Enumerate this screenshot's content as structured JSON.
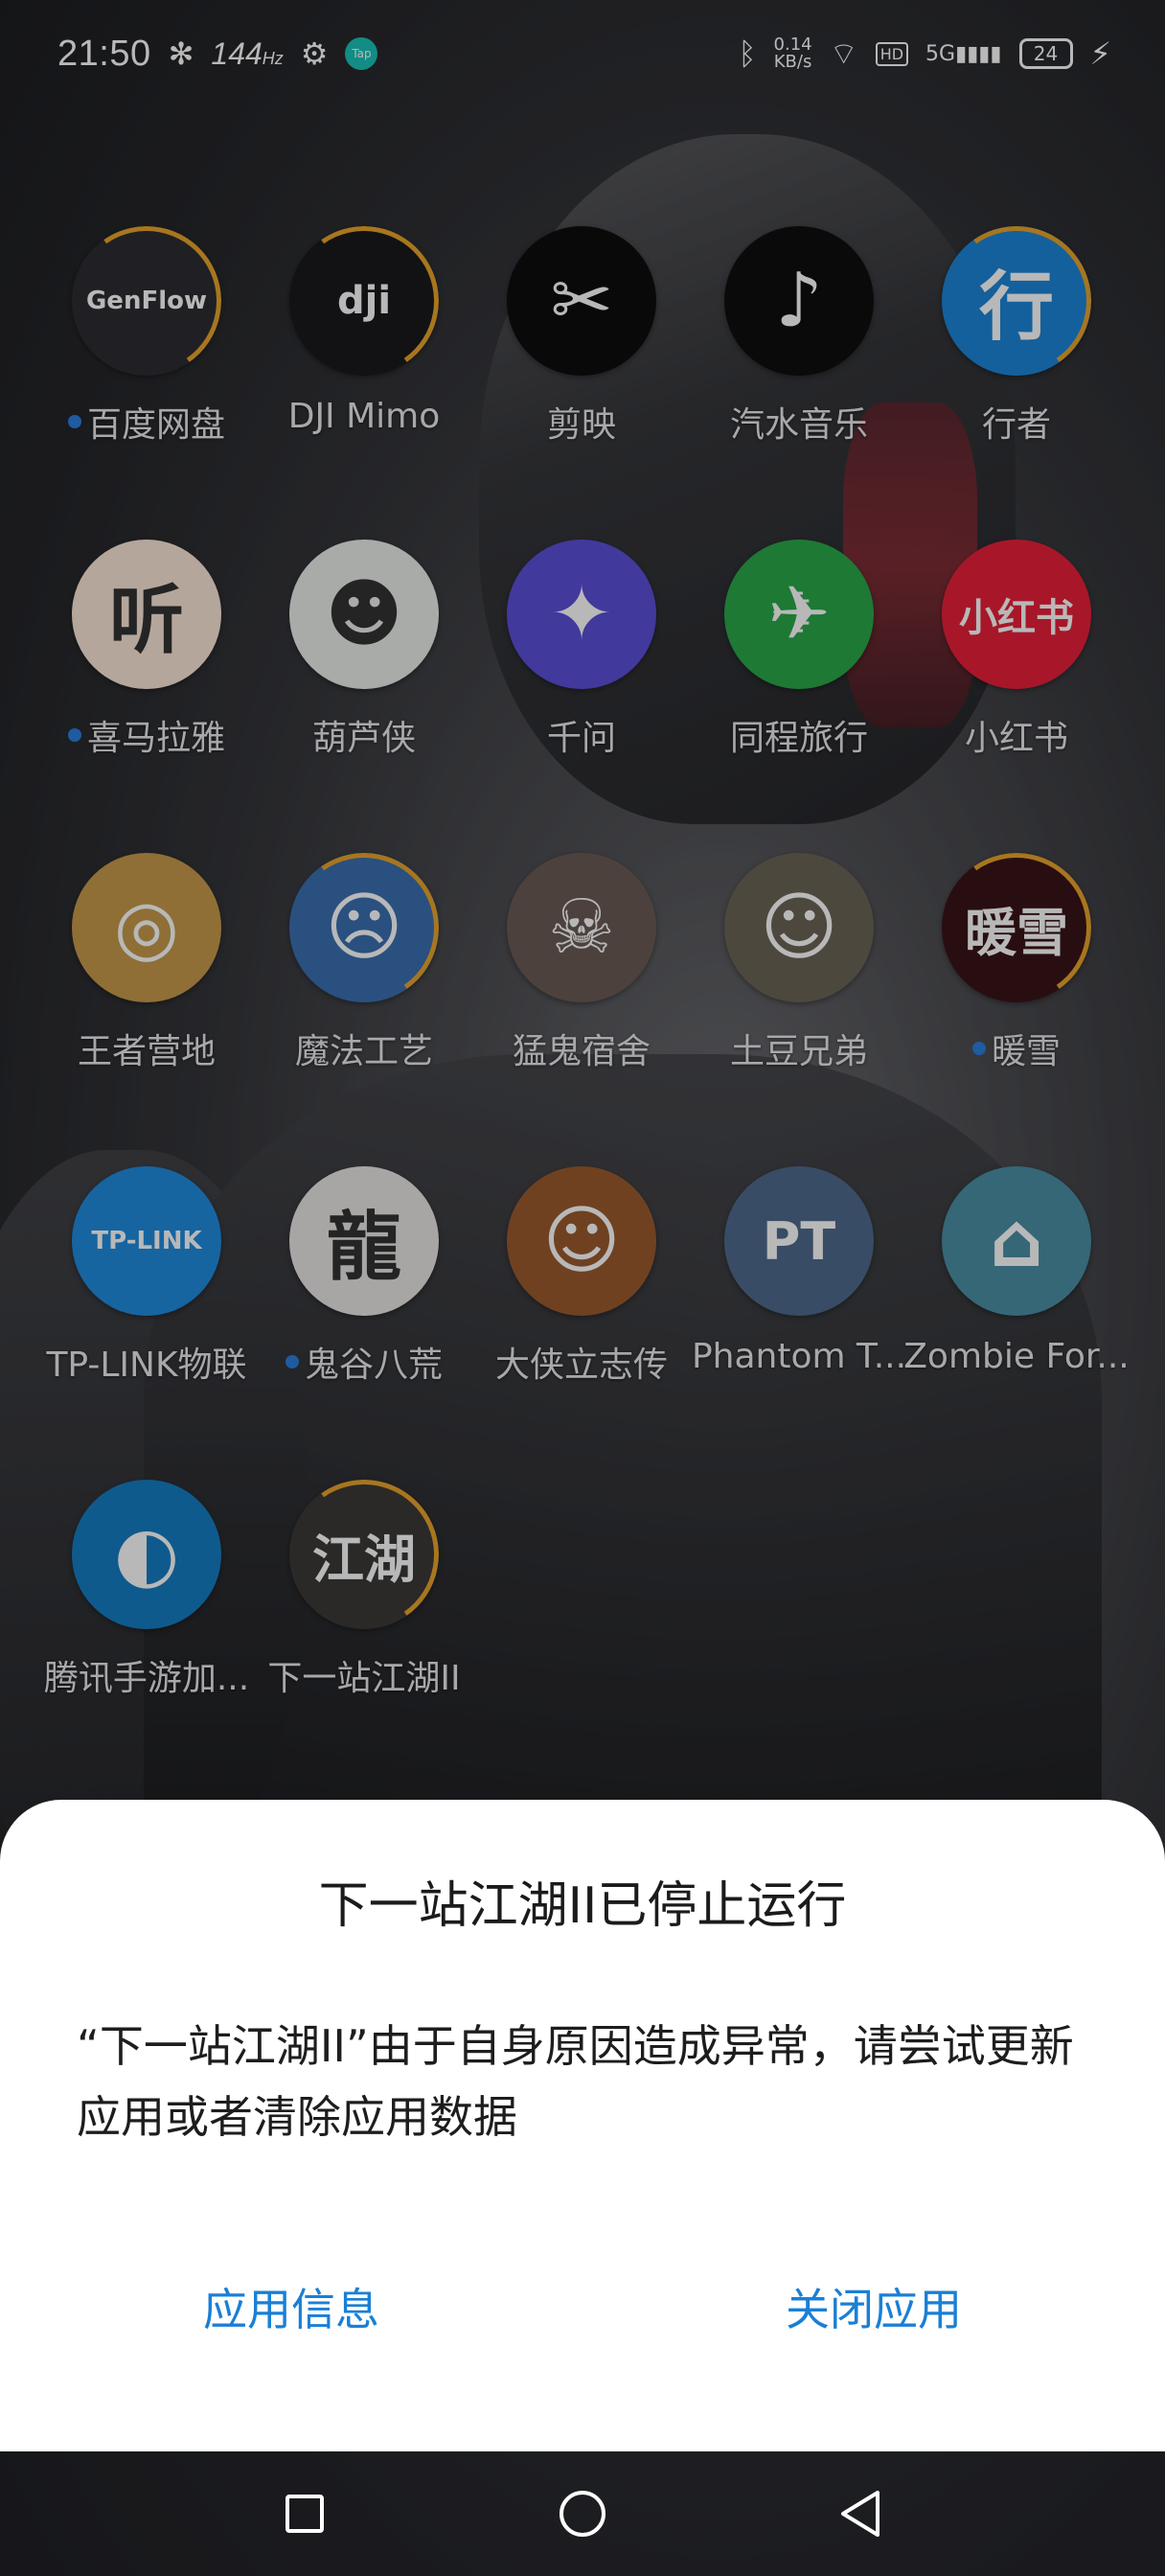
{
  "status_bar": {
    "time": "21:50",
    "refresh_rate": "144",
    "refresh_unit": "Hz",
    "tap_badge": "Tap",
    "net_speed_value": "0.14",
    "net_speed_unit": "KB/s",
    "hd_label": "HD",
    "network": "5G",
    "battery": "24"
  },
  "apps": [
    {
      "label": "百度网盘",
      "icon": "baidu-netdisk-icon",
      "glyph": "GenFlow",
      "color": "#2d2d33",
      "dot": true
    },
    {
      "label": "DJI Mimo",
      "icon": "dji-icon",
      "glyph": "dji",
      "color": "#1a1a1c",
      "dot": false
    },
    {
      "label": "剪映",
      "icon": "capcut-icon",
      "glyph": "✂",
      "color": "#0d0d0f",
      "dot": false
    },
    {
      "label": "汽水音乐",
      "icon": "qishui-music-icon",
      "glyph": "♪",
      "color": "#0f0f10",
      "dot": false
    },
    {
      "label": "行者",
      "icon": "xingzhe-icon",
      "glyph": "行",
      "color": "#1d86d8",
      "dot": false
    },
    {
      "label": "喜马拉雅",
      "icon": "ximalaya-icon",
      "glyph": "听",
      "color": "#fbe6d9",
      "dot": true
    },
    {
      "label": "葫芦侠",
      "icon": "huluxia-icon",
      "glyph": "☻",
      "color": "#e9eee9",
      "dot": false
    },
    {
      "label": "千问",
      "icon": "qianwen-icon",
      "glyph": "✦",
      "color": "#5a4fd8",
      "dot": false
    },
    {
      "label": "同程旅行",
      "icon": "tongcheng-icon",
      "glyph": "✈",
      "color": "#2aa84a",
      "dot": false
    },
    {
      "label": "小红书",
      "icon": "xiaohongshu-icon",
      "glyph": "小红书",
      "color": "#e8213a",
      "dot": false
    },
    {
      "label": "王者营地",
      "icon": "wangzhe-camp-icon",
      "glyph": "◎",
      "color": "#c79a4b",
      "dot": false
    },
    {
      "label": "魔法工艺",
      "icon": "magic-craft-icon",
      "glyph": "☹",
      "color": "#3b6fb0",
      "dot": false
    },
    {
      "label": "猛鬼宿舍",
      "icon": "ghost-dorm-icon",
      "glyph": "☠",
      "color": "#6a5b55",
      "dot": false
    },
    {
      "label": "土豆兄弟",
      "icon": "brotato-icon",
      "glyph": "☺",
      "color": "#6b6456",
      "dot": false
    },
    {
      "label": "暖雪",
      "icon": "warm-snow-icon",
      "glyph": "暖雪",
      "color": "#3a1418",
      "dot": true
    },
    {
      "label": "TP-LINK物联",
      "icon": "tp-link-icon",
      "glyph": "TP-LINK",
      "color": "#1f8de0",
      "dot": false
    },
    {
      "label": "鬼谷八荒",
      "icon": "guigu-bahuang-icon",
      "glyph": "龍",
      "color": "#e9e7e4",
      "dot": true
    },
    {
      "label": "大侠立志传",
      "icon": "daxia-icon",
      "glyph": "☺",
      "color": "#9a5b2e",
      "dot": false
    },
    {
      "label": "Phantom T...",
      "icon": "phantom-tower-icon",
      "glyph": "PT",
      "color": "#4f6a8c",
      "dot": false
    },
    {
      "label": "Zombie For...",
      "icon": "zombie-fortress-icon",
      "glyph": "⌂",
      "color": "#4a8fa6",
      "dot": false
    },
    {
      "label": "腾讯手游加...",
      "icon": "tencent-booster-icon",
      "glyph": "◐",
      "color": "#157dc2",
      "dot": false
    },
    {
      "label": "下一站江湖II",
      "icon": "jianghu-icon",
      "glyph": "江湖",
      "color": "#3b3a38",
      "dot": false
    }
  ],
  "dialog": {
    "title": "下一站江湖II已停止运行",
    "message": "“下一站江湖II”由于自身原因造成异常，请尝试更新应用或者清除应用数据",
    "button_info": "应用信息",
    "button_close": "关闭应用"
  }
}
